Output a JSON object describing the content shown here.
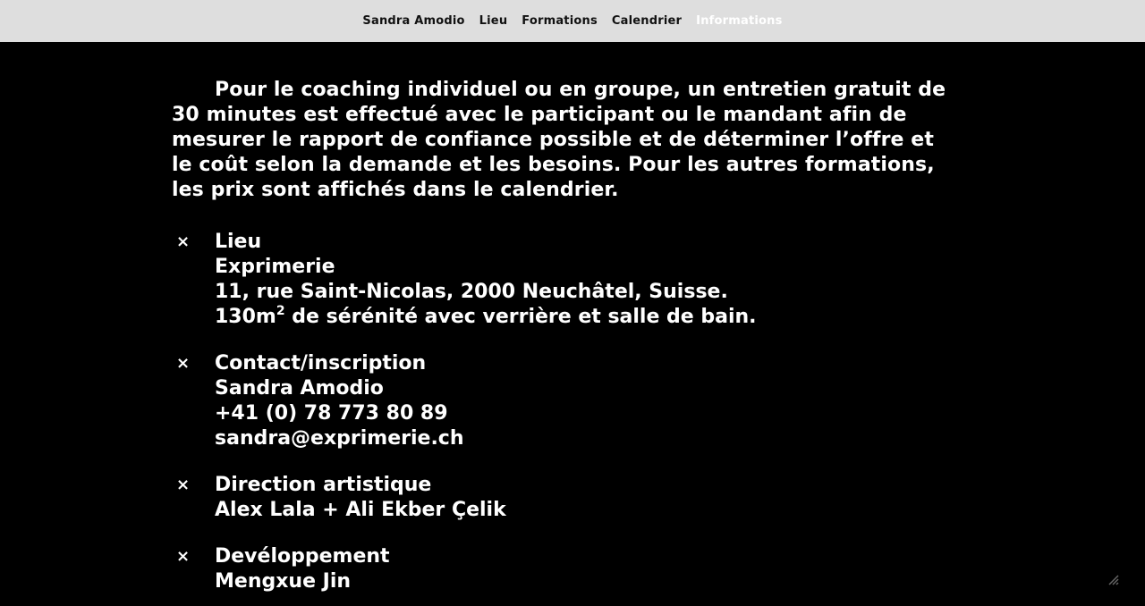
{
  "nav": {
    "items": [
      {
        "label": "Sandra Amodio"
      },
      {
        "label": "Lieu"
      },
      {
        "label": "Formations"
      },
      {
        "label": "Calendrier"
      },
      {
        "label": "Informations"
      }
    ],
    "active_index": 4
  },
  "intro": "Pour le coaching individuel ou en groupe, un entretien gratuit de 30 minutes est effectué avec le participant ou le mandant afin de mesurer le rapport de confiance possible et de déterminer l’offre et le coût selon la demande et les besoins. Pour les autres formations, les prix sont affichés dans le calendrier.",
  "marker": "×",
  "sections": {
    "lieu": {
      "title": "Lieu",
      "name": "Exprimerie",
      "address": "11, rue Saint-Nicolas, 2000 Neuchâtel, Suisse.",
      "area_value": "130m",
      "area_sup": "2",
      "area_rest": " de sérénité avec verrière et salle de bain."
    },
    "contact": {
      "title": "Contact/inscription",
      "name": "Sandra Amodio",
      "phone": "+41 (0) 78 773 80 89",
      "email": "sandra@exprimerie.ch"
    },
    "direction": {
      "title": "Direction artistique",
      "names": "Alex Lala + Ali Ekber Çelik"
    },
    "dev": {
      "title": "Devéloppement",
      "name": "Mengxue Jin"
    }
  },
  "colors": {
    "nav_bg": "#dedede",
    "page_bg": "#000000",
    "text": "#ffffff",
    "nav_text": "#111111",
    "nav_active": "#ffffff"
  },
  "icons": {
    "corner": "expand-icon"
  }
}
